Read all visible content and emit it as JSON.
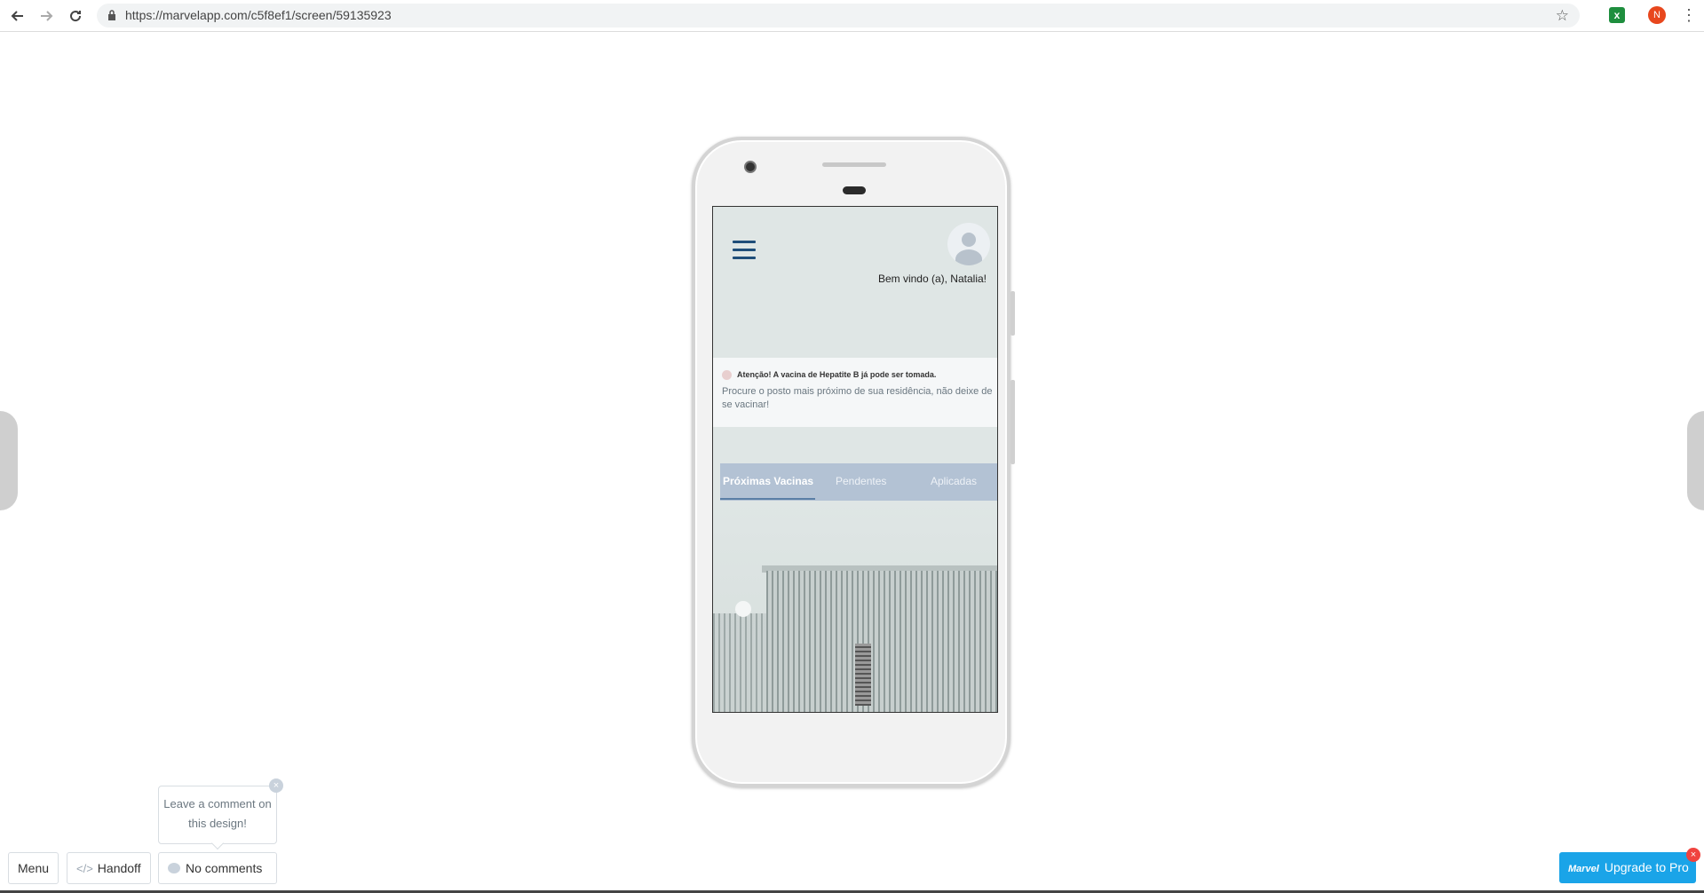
{
  "browser": {
    "url": "https://marvelapp.com/c5f8ef1/screen/59135923",
    "profile_initial": "N",
    "extension_letter": "x"
  },
  "app": {
    "welcome": "Bem vindo (a), Natalia!",
    "alert": {
      "title": "Atenção! A vacina de Hepatite B já pode ser tomada.",
      "body": "Procure o posto mais próximo de sua residência, não deixe de se vacinar!"
    },
    "tabs": [
      {
        "label": "Próximas Vacinas",
        "active": true
      },
      {
        "label": "Pendentes",
        "active": false
      },
      {
        "label": "Aplicadas",
        "active": false
      }
    ]
  },
  "marvel": {
    "tooltip": "Leave a comment on this design!",
    "menu_label": "Menu",
    "handoff_label": "Handoff",
    "comments_label": "No comments",
    "upgrade_logo": "Marvel",
    "upgrade_label": "Upgrade to Pro"
  },
  "colors": {
    "accent": "#1aa4e8",
    "tab_bar": "#b3c2d4",
    "hamburger": "#1f4e79"
  }
}
